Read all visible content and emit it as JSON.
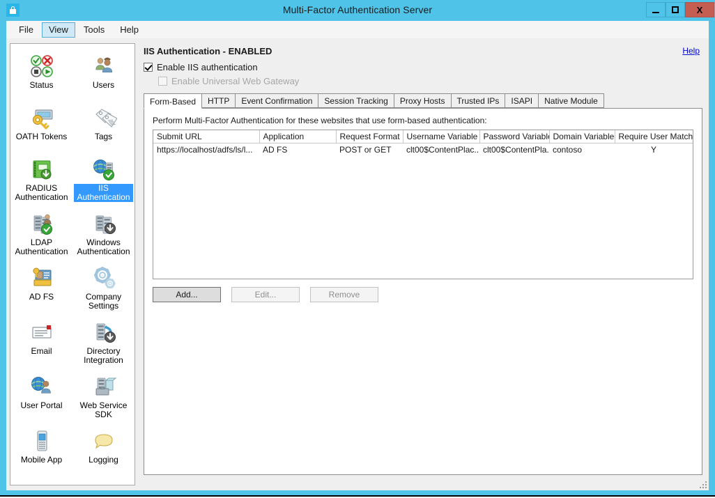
{
  "window": {
    "title": "Multi-Factor Authentication Server",
    "app_icon": "lock-icon",
    "controls": {
      "minimize": "minimize-button",
      "maximize": "maximize-button",
      "close_label": "X"
    }
  },
  "menubar": {
    "items": [
      {
        "label": "File",
        "active": false
      },
      {
        "label": "View",
        "active": true
      },
      {
        "label": "Tools",
        "active": false
      },
      {
        "label": "Help",
        "active": false
      }
    ]
  },
  "sidebar": {
    "items": [
      {
        "label": "Status",
        "icon": "status-icon",
        "selected": false
      },
      {
        "label": "Users",
        "icon": "users-icon",
        "selected": false
      },
      {
        "label": "OATH Tokens",
        "icon": "oath-tokens-icon",
        "selected": false
      },
      {
        "label": "Tags",
        "icon": "tags-icon",
        "selected": false
      },
      {
        "label": "RADIUS Authentication",
        "icon": "radius-authentication-icon",
        "selected": false
      },
      {
        "label": "IIS Authentication",
        "icon": "iis-authentication-icon",
        "selected": true
      },
      {
        "label": "LDAP Authentication",
        "icon": "ldap-authentication-icon",
        "selected": false
      },
      {
        "label": "Windows Authentication",
        "icon": "windows-authentication-icon",
        "selected": false
      },
      {
        "label": "AD FS",
        "icon": "adfs-icon",
        "selected": false
      },
      {
        "label": "Company Settings",
        "icon": "company-settings-icon",
        "selected": false
      },
      {
        "label": "Email",
        "icon": "email-icon",
        "selected": false
      },
      {
        "label": "Directory Integration",
        "icon": "directory-integration-icon",
        "selected": false
      },
      {
        "label": "User Portal",
        "icon": "user-portal-icon",
        "selected": false
      },
      {
        "label": "Web Service SDK",
        "icon": "web-service-sdk-icon",
        "selected": false
      },
      {
        "label": "Mobile App",
        "icon": "mobile-app-icon",
        "selected": false
      },
      {
        "label": "Logging",
        "icon": "logging-icon",
        "selected": false
      }
    ]
  },
  "main": {
    "page_title": "IIS Authentication - ENABLED",
    "help_link": "Help",
    "checkboxes": [
      {
        "label": "Enable IIS authentication",
        "checked": true,
        "disabled": false
      },
      {
        "label": "Enable Universal Web Gateway",
        "checked": false,
        "disabled": true
      }
    ],
    "tabs": [
      {
        "label": "Form-Based",
        "active": true
      },
      {
        "label": "HTTP",
        "active": false
      },
      {
        "label": "Event Confirmation",
        "active": false
      },
      {
        "label": "Session Tracking",
        "active": false
      },
      {
        "label": "Proxy Hosts",
        "active": false
      },
      {
        "label": "Trusted IPs",
        "active": false
      },
      {
        "label": "ISAPI",
        "active": false
      },
      {
        "label": "Native Module",
        "active": false
      }
    ],
    "tab_description": "Perform Multi-Factor Authentication for these websites that use form-based authentication:",
    "table": {
      "columns": [
        "Submit URL",
        "Application",
        "Request Format",
        "Username Variable",
        "Password Variable",
        "Domain Variable",
        "Require User Match"
      ],
      "rows": [
        [
          "https://localhost/adfs/ls/l...",
          "AD FS",
          "POST or GET",
          "clt00$ContentPlac...",
          "clt00$ContentPla...",
          "contoso",
          "Y"
        ]
      ]
    },
    "buttons": [
      {
        "label": "Add...",
        "state": "primary"
      },
      {
        "label": "Edit...",
        "state": "disabled"
      },
      {
        "label": "Remove",
        "state": "disabled"
      }
    ]
  },
  "colors": {
    "titlebar": "#4fc3e8",
    "close_button": "#c45d52",
    "selection": "#3399ff",
    "link": "#0000cc",
    "client_background": "#efefef"
  }
}
